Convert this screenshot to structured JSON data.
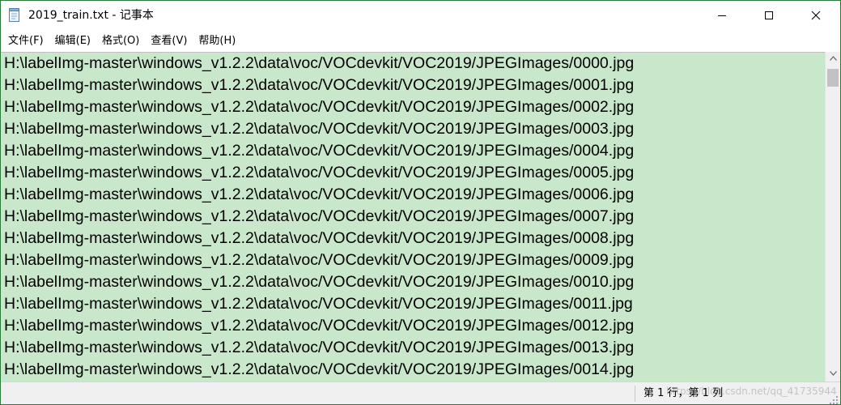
{
  "window": {
    "title": "2019_train.txt - 记事本"
  },
  "menu": [
    {
      "label": "文件(F)"
    },
    {
      "label": "编辑(E)"
    },
    {
      "label": "格式(O)"
    },
    {
      "label": "查看(V)"
    },
    {
      "label": "帮助(H)"
    }
  ],
  "lines": [
    "H:\\labelImg-master\\windows_v1.2.2\\data\\voc/VOCdevkit/VOC2019/JPEGImages/0000.jpg",
    "H:\\labelImg-master\\windows_v1.2.2\\data\\voc/VOCdevkit/VOC2019/JPEGImages/0001.jpg",
    "H:\\labelImg-master\\windows_v1.2.2\\data\\voc/VOCdevkit/VOC2019/JPEGImages/0002.jpg",
    "H:\\labelImg-master\\windows_v1.2.2\\data\\voc/VOCdevkit/VOC2019/JPEGImages/0003.jpg",
    "H:\\labelImg-master\\windows_v1.2.2\\data\\voc/VOCdevkit/VOC2019/JPEGImages/0004.jpg",
    "H:\\labelImg-master\\windows_v1.2.2\\data\\voc/VOCdevkit/VOC2019/JPEGImages/0005.jpg",
    "H:\\labelImg-master\\windows_v1.2.2\\data\\voc/VOCdevkit/VOC2019/JPEGImages/0006.jpg",
    "H:\\labelImg-master\\windows_v1.2.2\\data\\voc/VOCdevkit/VOC2019/JPEGImages/0007.jpg",
    "H:\\labelImg-master\\windows_v1.2.2\\data\\voc/VOCdevkit/VOC2019/JPEGImages/0008.jpg",
    "H:\\labelImg-master\\windows_v1.2.2\\data\\voc/VOCdevkit/VOC2019/JPEGImages/0009.jpg",
    "H:\\labelImg-master\\windows_v1.2.2\\data\\voc/VOCdevkit/VOC2019/JPEGImages/0010.jpg",
    "H:\\labelImg-master\\windows_v1.2.2\\data\\voc/VOCdevkit/VOC2019/JPEGImages/0011.jpg",
    "H:\\labelImg-master\\windows_v1.2.2\\data\\voc/VOCdevkit/VOC2019/JPEGImages/0012.jpg",
    "H:\\labelImg-master\\windows_v1.2.2\\data\\voc/VOCdevkit/VOC2019/JPEGImages/0013.jpg",
    "H:\\labelImg-master\\windows_v1.2.2\\data\\voc/VOCdevkit/VOC2019/JPEGImages/0014.jpg"
  ],
  "status": {
    "position": "第 1 行，第 1 列",
    "watermark": "https://blog.csdn.net/qq_41735944"
  },
  "colors": {
    "editor_background": "#c9e8cb",
    "window_border": "#2b7a3a"
  },
  "icons": {
    "app": "notepad-icon",
    "minimize": "minimize-icon",
    "maximize": "maximize-icon",
    "close": "close-icon",
    "scroll_up": "chevron-up-icon",
    "scroll_down": "chevron-down-icon"
  }
}
